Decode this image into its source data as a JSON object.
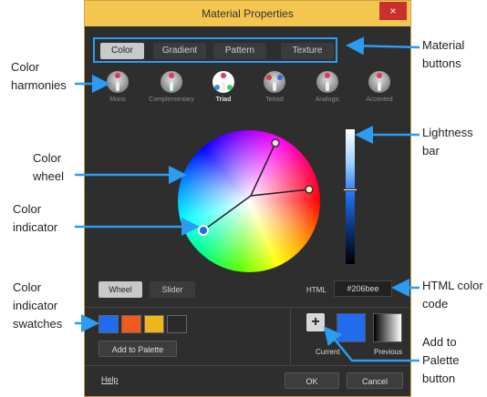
{
  "window": {
    "title": "Material Properties",
    "close_glyph": "×"
  },
  "tabs": [
    {
      "label": "Color",
      "active": true
    },
    {
      "label": "Gradient",
      "active": false
    },
    {
      "label": "Pattern",
      "active": false
    },
    {
      "label": "Texture",
      "active": false
    }
  ],
  "harmonies": [
    {
      "label": "Mono",
      "active": false
    },
    {
      "label": "Complementary",
      "active": false
    },
    {
      "label": "Triad",
      "active": true
    },
    {
      "label": "Tetrad",
      "active": false
    },
    {
      "label": "Analogic",
      "active": false
    },
    {
      "label": "Accented",
      "active": false
    }
  ],
  "mode": {
    "wheel_label": "Wheel",
    "slider_label": "Slider",
    "active": "Wheel"
  },
  "html_code": {
    "label": "HTML",
    "value": "#206bee"
  },
  "swatches": [
    "#206bee",
    "#f05a1e",
    "#f0b41e",
    "#2a2a2a"
  ],
  "palette": {
    "add_label": "Add to Palette",
    "plus_glyph": "+"
  },
  "current_label": "Current",
  "previous_label": "Previous",
  "current_color": "#206bee",
  "footer": {
    "help": "Help",
    "ok": "OK",
    "cancel": "Cancel"
  },
  "annotations": {
    "color_harmonies": "Color harmonies",
    "color_wheel": "Color wheel",
    "color_indicator": "Color indicator",
    "color_indicator_swatches": "Color indicator swatches",
    "material_buttons": "Material buttons",
    "lightness_bar": "Lightness bar",
    "html_color_code": "HTML color code",
    "add_to_palette_button": "Add to Palette button"
  },
  "accent_color": "#2d9bf0"
}
